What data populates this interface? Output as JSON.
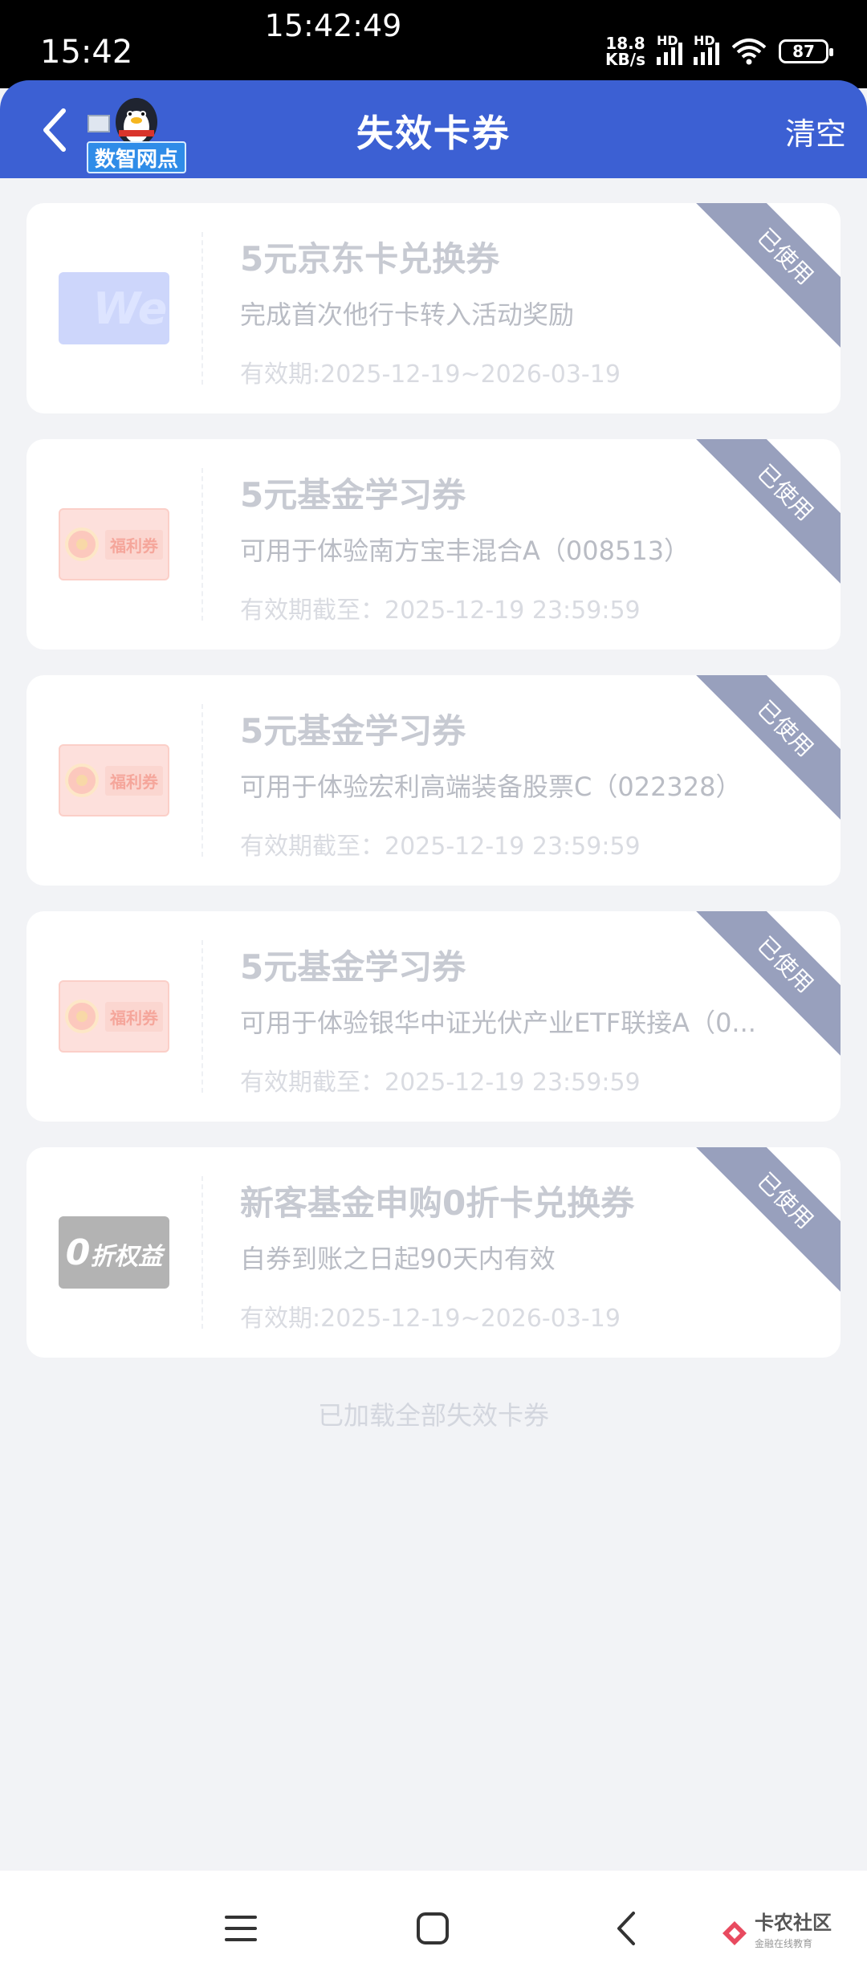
{
  "status_bar": {
    "time": "15:42",
    "center_time": "15:42:49",
    "net_speed_value": "18.8",
    "net_speed_unit": "KB/s",
    "hd_label": "HD",
    "battery": "87"
  },
  "header": {
    "title": "失效卡券",
    "clear_label": "清空",
    "mascot_label": "数智网点"
  },
  "coupons": [
    {
      "title": "5元京东卡兑换券",
      "desc": "完成首次他行卡转入活动奖励",
      "validity": "有效期:2025-12-19~2026-03-19",
      "badge": "已使用",
      "thumb": "jd-card-thumbnail",
      "thumb_text": "We"
    },
    {
      "title": "5元基金学习券",
      "desc": "可用于体验南方宝丰混合A（008513）",
      "validity": "有效期截至：2025-12-19 23:59:59",
      "badge": "已使用",
      "thumb": "fuli-coupon-thumbnail",
      "thumb_text": "福利券"
    },
    {
      "title": "5元基金学习券",
      "desc": "可用于体验宏利高端装备股票C（022328）",
      "validity": "有效期截至：2025-12-19 23:59:59",
      "badge": "已使用",
      "thumb": "fuli-coupon-thumbnail",
      "thumb_text": "福利券"
    },
    {
      "title": "5元基金学习券",
      "desc": "可用于体验银华中证光伏产业ETF联接A（0...",
      "validity": "有效期截至：2025-12-19 23:59:59",
      "badge": "已使用",
      "thumb": "fuli-coupon-thumbnail",
      "thumb_text": "福利券"
    },
    {
      "title": "新客基金申购0折卡兑换券",
      "desc": "自券到账之日起90天内有效",
      "validity": "有效期:2025-12-19~2026-03-19",
      "badge": "已使用",
      "thumb": "zero-discount-thumbnail",
      "thumb_text_big": "0",
      "thumb_text": "折权益"
    }
  ],
  "footer_text": "已加载全部失效卡券",
  "watermark": {
    "title": "卡农社区",
    "subtitle": "金融在线教育"
  },
  "colors": {
    "header_bg": "#3c60d3",
    "page_bg": "#f2f3f6",
    "badge_bg": "#98a0bd"
  }
}
